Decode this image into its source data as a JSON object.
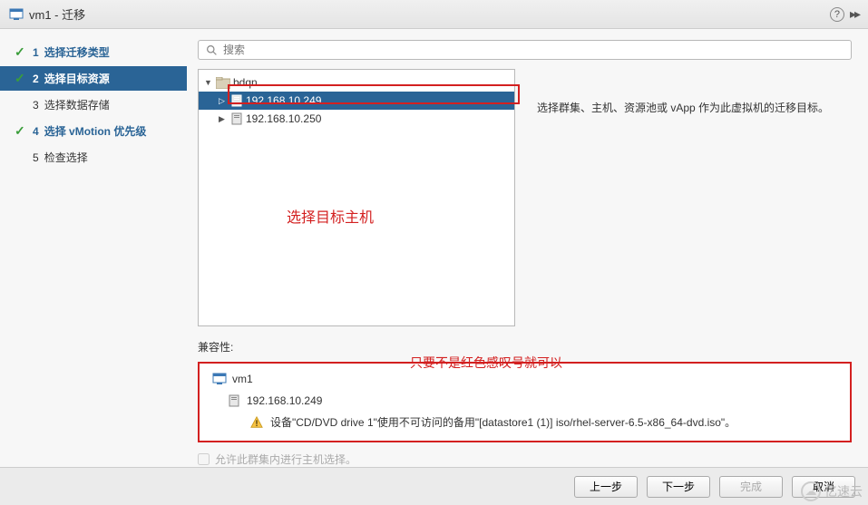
{
  "titlebar": {
    "title": "vm1 - 迁移"
  },
  "steps": [
    {
      "num": "1",
      "label": "选择迁移类型",
      "done": true,
      "active": false
    },
    {
      "num": "2",
      "label": "选择目标资源",
      "done": true,
      "active": true
    },
    {
      "num": "3",
      "label": "选择数据存储",
      "done": false,
      "active": false
    },
    {
      "num": "4",
      "label": "选择 vMotion 优先级",
      "done": true,
      "active": false
    },
    {
      "num": "5",
      "label": "检查选择",
      "done": false,
      "active": false
    }
  ],
  "search": {
    "placeholder": "搜索"
  },
  "tree": {
    "root": "bdqn",
    "hosts": [
      {
        "ip": "192.168.10.249",
        "selected": true
      },
      {
        "ip": "192.168.10.250",
        "selected": false
      }
    ]
  },
  "info": {
    "text": "选择群集、主机、资源池或 vApp 作为此虚拟机的迁移目标。"
  },
  "annotations": {
    "select_host": "选择目标主机",
    "warn_ok": "只要不是红色感叹号就可以"
  },
  "compat": {
    "label": "兼容性:",
    "vm": "vm1",
    "host": "192.168.10.249",
    "warning": "设备\"CD/DVD drive 1\"使用不可访问的备用\"[datastore1 (1)] iso/rhel-server-6.5-x86_64-dvd.iso\"。"
  },
  "cluster_checkbox": {
    "label": "允许此群集内进行主机选择。"
  },
  "buttons": {
    "back": "上一步",
    "next": "下一步",
    "finish": "完成",
    "cancel": "取消"
  },
  "watermark": "亿速云"
}
